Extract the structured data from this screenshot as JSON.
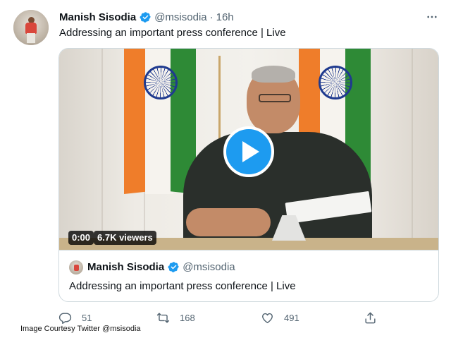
{
  "tweet": {
    "author_name": "Manish Sisodia",
    "handle": "@msisodia",
    "separator": "·",
    "time": "16h",
    "text": "Addressing an important press conference | Live",
    "more_icon": "more-horizontal-icon"
  },
  "video": {
    "play_icon": "play-icon",
    "elapsed": "0:00",
    "viewers": "6.7K viewers"
  },
  "card": {
    "author_name": "Manish Sisodia",
    "handle": "@msisodia",
    "text": "Addressing an important press conference | Live"
  },
  "actions": {
    "reply": {
      "icon": "reply-icon",
      "count": "51"
    },
    "retweet": {
      "icon": "retweet-icon",
      "count": "168"
    },
    "like": {
      "icon": "heart-icon",
      "count": "491"
    },
    "share": {
      "icon": "share-icon"
    }
  },
  "caption": "Image Courtesy Twitter @msisodia",
  "colors": {
    "accent": "#1d9bf0",
    "text_primary": "#0f1419",
    "text_secondary": "#536471",
    "border": "#cfd9de"
  }
}
